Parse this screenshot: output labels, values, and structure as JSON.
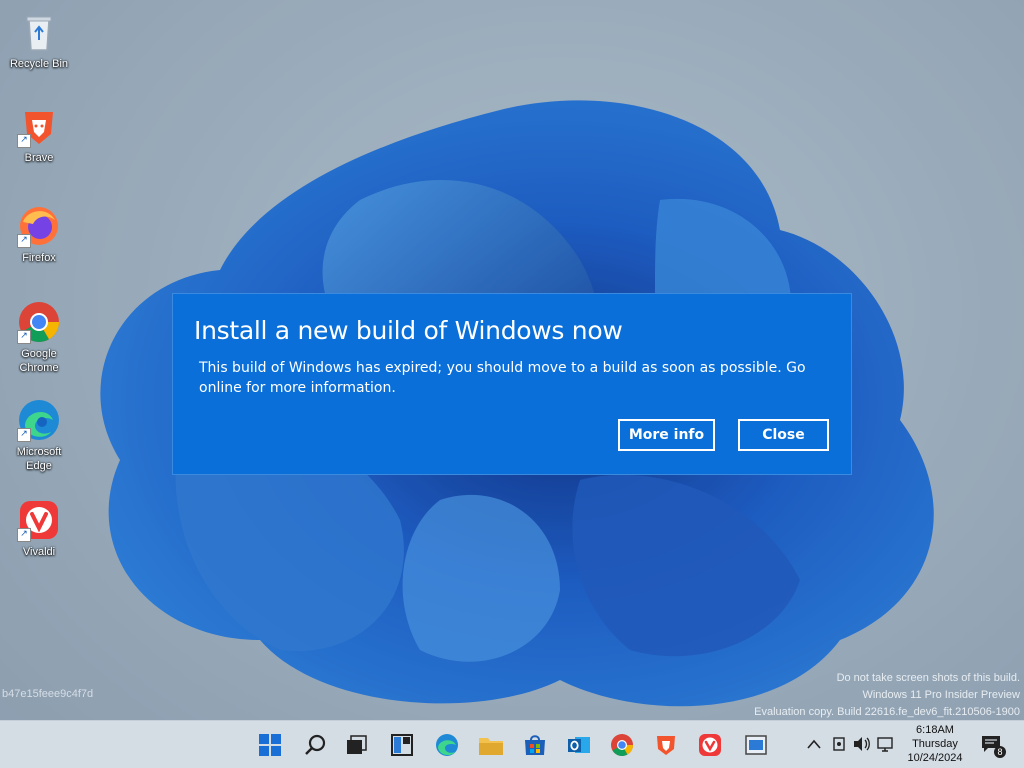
{
  "desktop": {
    "icons": [
      {
        "label": "Recycle Bin",
        "icon": "recycle-bin-icon"
      },
      {
        "label": "Brave",
        "icon": "brave-icon"
      },
      {
        "label": "Firefox",
        "icon": "firefox-icon"
      },
      {
        "label": "Google Chrome",
        "icon": "chrome-icon"
      },
      {
        "label": "Microsoft Edge",
        "icon": "edge-icon"
      },
      {
        "label": "Vivaldi",
        "icon": "vivaldi-icon"
      }
    ],
    "build_hash": "b47e15feee9c4f7d",
    "watermark": {
      "line1": "Do not take screen shots of this build.",
      "line2": "Windows 11 Pro Insider Preview",
      "line3": "Evaluation copy. Build 22616.fe_dev6_fit.210506-1900"
    }
  },
  "dialog": {
    "title": "Install a new build of Windows now",
    "message": "This build of Windows has expired; you should move to a build as soon as possible. Go online for more information.",
    "more_info_label": "More info",
    "close_label": "Close",
    "accent": "#0a6fd8"
  },
  "taskbar": {
    "apps": [
      "start-icon",
      "search-icon",
      "task-view-icon",
      "widgets-icon",
      "edge-icon",
      "file-explorer-icon",
      "store-icon",
      "outlook-icon",
      "chrome-icon",
      "brave-icon",
      "vivaldi-icon",
      "app-icon"
    ],
    "tray": [
      "chevron-up-icon",
      "device-icon",
      "volume-icon",
      "network-icon"
    ],
    "clock": {
      "time": "6:18AM",
      "day": "Thursday",
      "date": "10/24/2024"
    },
    "notifications": "8"
  }
}
